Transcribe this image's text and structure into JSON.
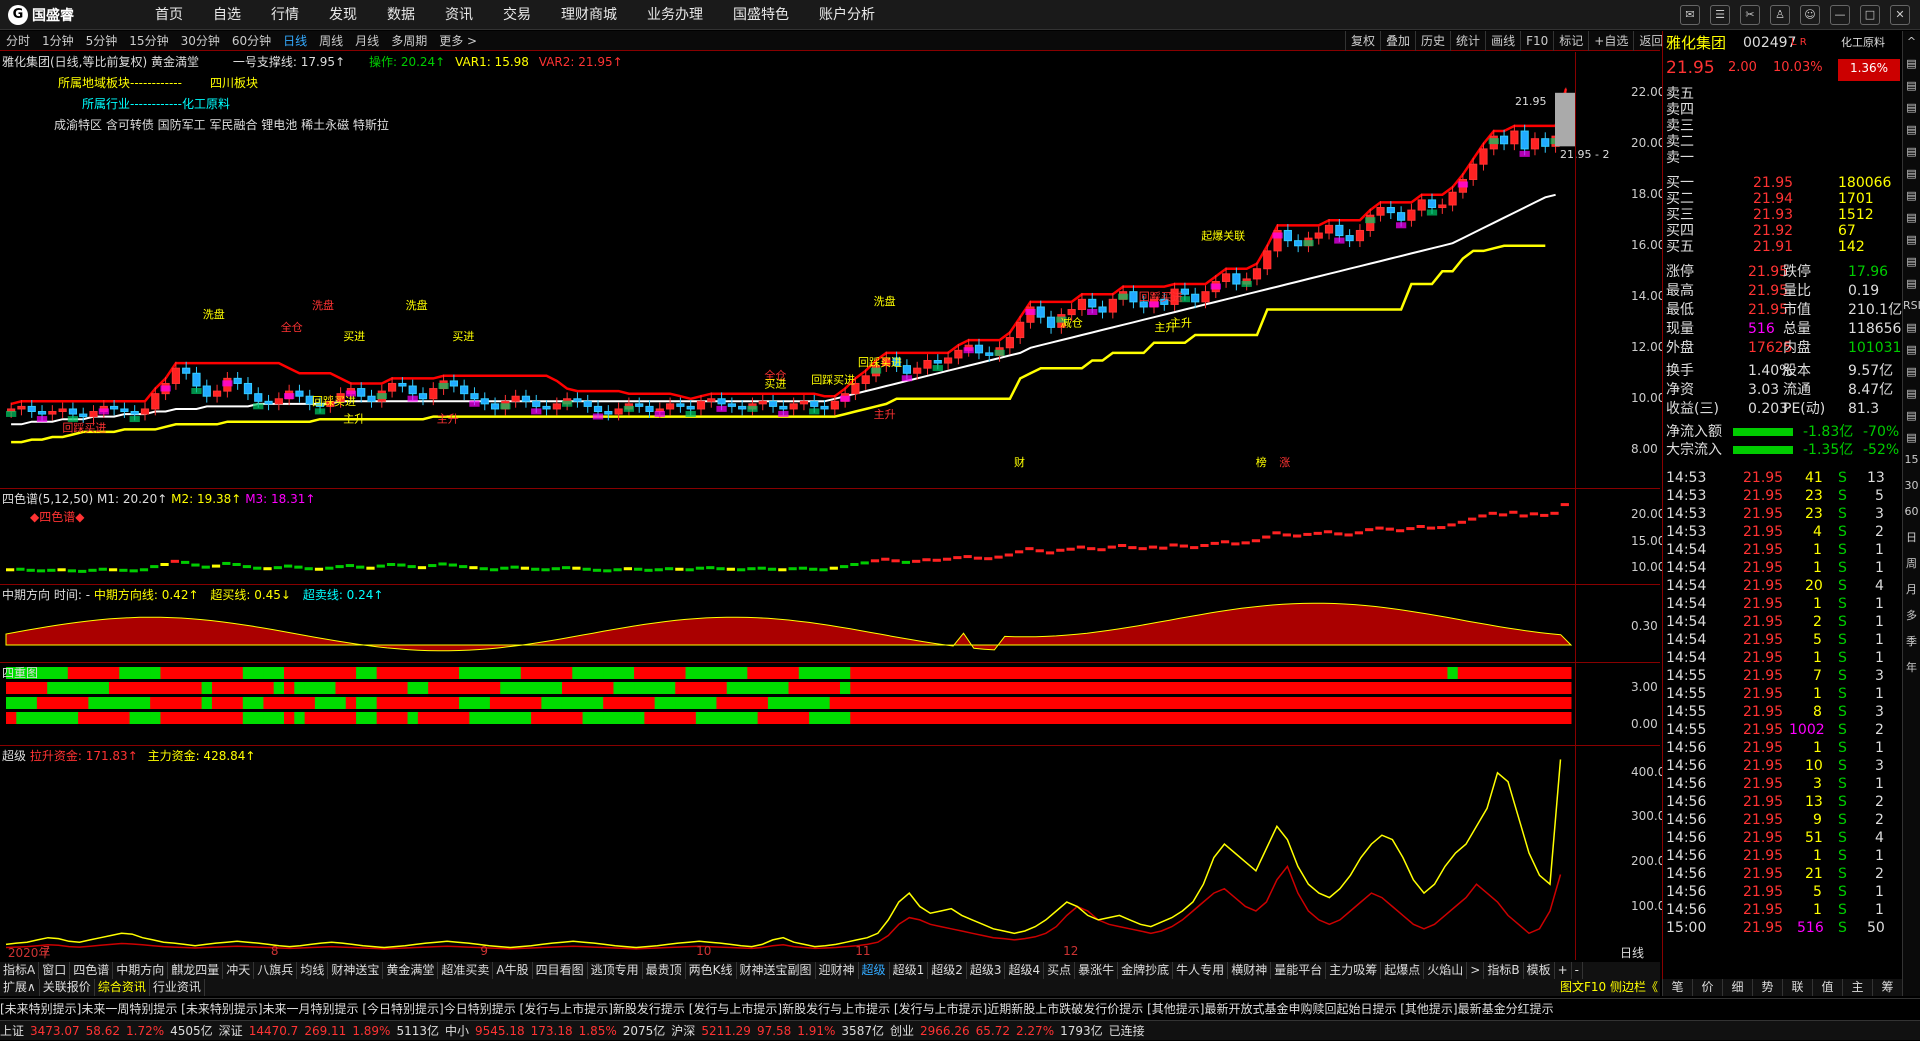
{
  "app": {
    "logo_text": "国盛睿",
    "logo_mark": "G",
    "menu": [
      "首页",
      "自选",
      "行情",
      "发现",
      "数据",
      "资讯",
      "交易",
      "理财商城",
      "业务办理",
      "国盛特色",
      "账户分析"
    ],
    "window_icons": [
      "message-icon",
      "mail-icon",
      "tools-icon",
      "shirt-icon",
      "user-icon",
      "minimize-icon",
      "maximize-icon",
      "close-icon"
    ]
  },
  "period_tabs": [
    "分时",
    "1分钟",
    "5分钟",
    "15分钟",
    "30分钟",
    "60分钟",
    "日线",
    "周线",
    "月线",
    "多周期",
    "更多 >"
  ],
  "active_period": "日线",
  "tool_buttons": [
    "复权",
    "叠加",
    "历史",
    "统计",
    "画线",
    "F10",
    "标记",
    "+自选",
    "返回"
  ],
  "main_header": {
    "title": "雅化集团(日线,等比前复权)",
    "formula": "黄金満堂",
    "support": "一号支撑线: 17.95↑",
    "op": "操作: 20.24↑",
    "var1": "VAR1: 15.98",
    "var2": "VAR2: 21.95↑"
  },
  "info_lines": {
    "region_label": "所属地域板块------------",
    "region_value": "四川板块",
    "industry_label": "所属行业------------化工原料",
    "concepts": "成渝特区 含可转债 国防军工 军民融合 锂电池 稀土永磁 特斯拉"
  },
  "main_axis": [
    "22.00",
    "20.00",
    "18.00",
    "16.00",
    "14.00",
    "12.00",
    "10.00",
    "8.00"
  ],
  "price_labels": {
    "high": "21.95",
    "right": "21.95 - 2"
  },
  "chart_annotations": [
    "洗盘",
    "洗盘",
    "洗盘",
    "洗盘",
    "全仓",
    "买进",
    "买进",
    "回踩买进",
    "回踩买进",
    "主升",
    "主升",
    "回踩买进",
    "起爆关联",
    "回踩买进",
    "主升",
    "主升",
    "全仓",
    "买进",
    "回踩买进",
    "主升",
    "财",
    "榜",
    "涨",
    "减仓"
  ],
  "panel2": {
    "title": "四色谱(5,12,50)",
    "m1": "M1: 20.20↑",
    "m2": "M2: 19.38↑",
    "m3": "M3: 18.31↑",
    "label": "◆四色谱◆",
    "axis": [
      "20.00",
      "15.00",
      "10.00"
    ]
  },
  "panel3": {
    "title": "中期方向",
    "time": "时间: -",
    "line": "中期方向线: 0.42↑",
    "buy": "超买线: 0.45↓",
    "sell": "超卖线: 0.24↑",
    "axis": [
      "0.30"
    ]
  },
  "panel4": {
    "title": "四重图",
    "axis": [
      "3.00",
      "0.00"
    ]
  },
  "panel5": {
    "title": "超级",
    "pull": "拉升资金: 171.83↑",
    "main": "主力资金: 428.84↑",
    "axis": [
      "400.0",
      "300.0",
      "200.0",
      "100.0"
    ]
  },
  "x_axis": [
    {
      "label": "2020年",
      "pos": 0.005
    },
    {
      "label": "7",
      "pos": 0.027
    },
    {
      "label": "8",
      "pos": 0.172
    },
    {
      "label": "9",
      "pos": 0.305
    },
    {
      "label": "10",
      "pos": 0.442
    },
    {
      "label": "11",
      "pos": 0.543
    },
    {
      "label": "12",
      "pos": 0.675
    }
  ],
  "x_axis_right": "日线",
  "bottom_tabs": [
    "指标A",
    "窗口",
    "四色谱",
    "中期方向",
    "麒龙四量",
    "冲天",
    "八旗兵",
    "均线",
    "财神送宝",
    "黄金满堂",
    "超准买卖",
    "A牛股",
    "四目看图",
    "逃顶专用",
    "最贵顶",
    "两色K线",
    "财神送宝副图",
    "迎财神",
    "超级",
    "超级1",
    "超级2",
    "超级3",
    "超级4",
    "买点",
    "暴涨牛",
    "金牌抄底",
    "牛人专用",
    "横财神",
    "量能平台",
    "主力吸筹",
    "起爆点",
    "火焰山",
    ">",
    "指标B",
    "模板",
    "+",
    "-"
  ],
  "active_tab": "超级",
  "bottom_tabs2": [
    "扩展∧",
    "关联报价",
    "综合资讯",
    "行业资讯"
  ],
  "bottom_tabs2_active": "综合资讯",
  "f10_label": "图文F10 侧边栏《",
  "stock": {
    "name": "雅化集团",
    "code": "002497",
    "tag": "L R",
    "industry": "化工原料",
    "industry_pct": "1.36%",
    "price": "21.95",
    "chg": "2.00",
    "pct": "10.03%"
  },
  "sell_levels": [
    "卖五",
    "卖四",
    "卖三",
    "卖二",
    "卖一"
  ],
  "buy_levels": [
    {
      "l": "买一",
      "p": "21.95",
      "v": "180066"
    },
    {
      "l": "买二",
      "p": "21.94",
      "v": "1701"
    },
    {
      "l": "买三",
      "p": "21.93",
      "v": "1512"
    },
    {
      "l": "买四",
      "p": "21.92",
      "v": "67"
    },
    {
      "l": "买五",
      "p": "21.91",
      "v": "142"
    }
  ],
  "stats": [
    {
      "a": "涨停",
      "av": "21.95",
      "b": "跌停",
      "bv": "17.96",
      "ac": "up",
      "bc": "dn"
    },
    {
      "a": "最高",
      "av": "21.95",
      "b": "量比",
      "bv": "0.19",
      "ac": "up",
      "bc": "wh"
    },
    {
      "a": "最低",
      "av": "21.95",
      "b": "市值",
      "bv": "210.1亿",
      "ac": "up",
      "bc": "wh"
    },
    {
      "a": "现量",
      "av": "516",
      "b": "总量",
      "bv": "118656",
      "ac": "mg",
      "bc": "wh"
    },
    {
      "a": "外盘",
      "av": "17625",
      "b": "内盘",
      "bv": "101031",
      "ac": "up",
      "bc": "dn"
    },
    {
      "a": "换手",
      "av": "1.40%",
      "b": "股本",
      "bv": "9.57亿",
      "ac": "wh",
      "bc": "wh"
    },
    {
      "a": "净资",
      "av": "3.03",
      "b": "流通",
      "bv": "8.47亿",
      "ac": "wh",
      "bc": "wh"
    },
    {
      "a": "收益(三)",
      "av": "0.203",
      "b": "PE(动)",
      "bv": "81.3",
      "ac": "wh",
      "bc": "wh"
    }
  ],
  "flows": [
    {
      "l": "净流入额",
      "v": "-1.83亿",
      "p": "-70%"
    },
    {
      "l": "大宗流入",
      "v": "-1.35亿",
      "p": "-52%"
    }
  ],
  "ticks": [
    [
      "14:53",
      "21.95",
      "41",
      "S",
      "13"
    ],
    [
      "14:53",
      "21.95",
      "23",
      "S",
      "5"
    ],
    [
      "14:53",
      "21.95",
      "23",
      "S",
      "3"
    ],
    [
      "14:53",
      "21.95",
      "4",
      "S",
      "2"
    ],
    [
      "14:54",
      "21.95",
      "1",
      "S",
      "1"
    ],
    [
      "14:54",
      "21.95",
      "1",
      "S",
      "1"
    ],
    [
      "14:54",
      "21.95",
      "20",
      "S",
      "4"
    ],
    [
      "14:54",
      "21.95",
      "1",
      "S",
      "1"
    ],
    [
      "14:54",
      "21.95",
      "2",
      "S",
      "1"
    ],
    [
      "14:54",
      "21.95",
      "5",
      "S",
      "1"
    ],
    [
      "14:54",
      "21.95",
      "1",
      "S",
      "1"
    ],
    [
      "14:55",
      "21.95",
      "7",
      "S",
      "3"
    ],
    [
      "14:55",
      "21.95",
      "1",
      "S",
      "1"
    ],
    [
      "14:55",
      "21.95",
      "8",
      "S",
      "3"
    ],
    [
      "14:55",
      "21.95",
      "1002",
      "S",
      "2"
    ],
    [
      "14:56",
      "21.95",
      "1",
      "S",
      "1"
    ],
    [
      "14:56",
      "21.95",
      "10",
      "S",
      "3"
    ],
    [
      "14:56",
      "21.95",
      "3",
      "S",
      "1"
    ],
    [
      "14:56",
      "21.95",
      "13",
      "S",
      "2"
    ],
    [
      "14:56",
      "21.95",
      "9",
      "S",
      "2"
    ],
    [
      "14:56",
      "21.95",
      "51",
      "S",
      "4"
    ],
    [
      "14:56",
      "21.95",
      "1",
      "S",
      "1"
    ],
    [
      "14:56",
      "21.95",
      "21",
      "S",
      "2"
    ],
    [
      "14:56",
      "21.95",
      "5",
      "S",
      "1"
    ],
    [
      "14:56",
      "21.95",
      "1",
      "S",
      "1"
    ],
    [
      "15:00",
      "21.95",
      "516",
      "S",
      "50"
    ]
  ],
  "right_tabs": [
    "笔",
    "价",
    "细",
    "势",
    "联",
    "值",
    "主",
    "筹"
  ],
  "sidebar_icons": [
    "^",
    "▤",
    "▤",
    "▤",
    "▤",
    "▤",
    "▤",
    "▤",
    "▤",
    "▤",
    "▤",
    "▤",
    "RSI",
    "▤",
    "▤",
    "▤",
    "▤",
    "▤",
    "▤",
    "15",
    "30",
    "60",
    "日",
    "周",
    "月",
    "多",
    "季",
    "年"
  ],
  "ticker": "[未来特别提示]未来一周特别提示   [未来特别提示]未来一月特别提示   [今日特别提示]今日特别提示   [发行与上市提示]新股发行提示   [发行与上市提示]新股发行与上市提示   [发行与上市提示]近期新股上市跌破发行价提示   [其他提示]最新开放式基金申购赎回起始日提示   [其他提示]最新基金分红提示",
  "status_items": [
    {
      "t": "上证",
      "c": "wh"
    },
    {
      "t": "3473.07",
      "c": "up"
    },
    {
      "t": "58.62",
      "c": "up"
    },
    {
      "t": "1.72%",
      "c": "up"
    },
    {
      "t": "4505亿",
      "c": "wh"
    },
    {
      "t": "深证",
      "c": "wh"
    },
    {
      "t": "14470.7",
      "c": "up"
    },
    {
      "t": "269.11",
      "c": "up"
    },
    {
      "t": "1.89%",
      "c": "up"
    },
    {
      "t": "5113亿",
      "c": "wh"
    },
    {
      "t": "中小",
      "c": "wh"
    },
    {
      "t": "9545.18",
      "c": "up"
    },
    {
      "t": "173.18",
      "c": "up"
    },
    {
      "t": "1.85%",
      "c": "up"
    },
    {
      "t": "2075亿",
      "c": "wh"
    },
    {
      "t": "沪深",
      "c": "wh"
    },
    {
      "t": "5211.29",
      "c": "up"
    },
    {
      "t": "97.58",
      "c": "up"
    },
    {
      "t": "1.91%",
      "c": "up"
    },
    {
      "t": "3587亿",
      "c": "wh"
    },
    {
      "t": "创业",
      "c": "wh"
    },
    {
      "t": "2966.26",
      "c": "up"
    },
    {
      "t": "65.72",
      "c": "up"
    },
    {
      "t": "2.27%",
      "c": "up"
    },
    {
      "t": "1793亿",
      "c": "wh"
    },
    {
      "t": "已连接",
      "c": "wh"
    }
  ],
  "chart_data": {
    "type": "candlestick",
    "ylim": [
      7,
      23
    ],
    "close": [
      9.6,
      9.7,
      9.5,
      9.4,
      9.5,
      9.6,
      9.4,
      9.3,
      9.5,
      9.7,
      9.6,
      9.5,
      9.4,
      9.6,
      10.2,
      10.6,
      11.2,
      11.0,
      10.5,
      10.1,
      10.3,
      10.8,
      10.6,
      10.2,
      9.9,
      9.8,
      10.0,
      10.3,
      10.1,
      9.8,
      9.7,
      9.9,
      10.2,
      10.4,
      10.1,
      9.9,
      10.3,
      10.6,
      10.5,
      10.2,
      10.0,
      10.4,
      10.7,
      10.5,
      10.2,
      10.0,
      9.8,
      9.6,
      9.9,
      10.1,
      9.9,
      9.7,
      9.6,
      9.8,
      10.0,
      9.9,
      9.7,
      9.5,
      9.4,
      9.6,
      9.8,
      9.7,
      9.5,
      9.6,
      9.8,
      9.7,
      9.6,
      9.9,
      10.0,
      9.8,
      9.7,
      9.6,
      9.8,
      9.9,
      9.7,
      9.6,
      9.8,
      9.9,
      9.7,
      9.6,
      9.9,
      10.2,
      10.6,
      10.9,
      11.3,
      11.6,
      11.3,
      11.0,
      11.2,
      11.5,
      11.4,
      11.6,
      11.9,
      12.1,
      11.8,
      11.7,
      12.0,
      12.4,
      13.0,
      13.6,
      13.2,
      12.8,
      13.3,
      13.5,
      13.9,
      13.6,
      13.4,
      13.9,
      14.2,
      13.8,
      13.6,
      13.9,
      13.7,
      14.3,
      14.1,
      13.8,
      14.2,
      14.6,
      14.9,
      14.5,
      14.7,
      15.1,
      15.8,
      16.6,
      16.2,
      16.0,
      16.3,
      16.5,
      16.8,
      16.4,
      16.2,
      16.6,
      17.2,
      17.5,
      17.3,
      17.0,
      17.4,
      17.8,
      17.5,
      17.6,
      18.1,
      18.6,
      19.2,
      19.8,
      20.3,
      20.0,
      20.5,
      19.8,
      20.2,
      19.9,
      20.3,
      21.95
    ],
    "support": [
      8.3,
      8.3,
      8.4,
      8.4,
      8.5,
      8.5,
      8.6,
      8.7,
      8.7,
      8.7,
      8.7,
      8.8,
      8.8,
      8.8,
      8.8,
      8.9,
      9.0,
      9.0,
      9.0,
      9.0,
      9.0,
      9.1,
      9.1,
      9.1,
      9.1,
      9.1,
      9.1,
      9.1,
      9.1,
      9.1,
      9.2,
      9.2,
      9.2,
      9.2,
      9.2,
      9.2,
      9.2,
      9.2,
      9.2,
      9.2,
      9.2,
      9.3,
      9.3,
      9.3,
      9.3,
      9.3,
      9.3,
      9.3,
      9.3,
      9.3,
      9.3,
      9.3,
      9.3,
      9.3,
      9.3,
      9.3,
      9.3,
      9.3,
      9.3,
      9.3,
      9.3,
      9.3,
      9.3,
      9.3,
      9.3,
      9.3,
      9.3,
      9.3,
      9.3,
      9.3,
      9.3,
      9.3,
      9.3,
      9.3,
      9.3,
      9.3,
      9.3,
      9.3,
      9.3,
      9.3,
      9.3,
      9.4,
      9.5,
      9.6,
      9.7,
      9.8,
      10.0,
      10.0,
      10.0,
      10.0,
      10.0,
      10.0,
      10.0,
      10.0,
      10.0,
      10.0,
      10.0,
      10.0,
      10.8,
      11.0,
      11.2,
      11.2,
      11.2,
      11.2,
      11.2,
      11.5,
      11.5,
      11.8,
      11.8,
      11.8,
      11.8,
      12.2,
      12.2,
      12.2,
      12.2,
      12.5,
      12.5,
      12.5,
      12.5,
      12.5,
      12.5,
      12.5,
      13.5,
      13.5,
      13.5,
      13.5,
      13.5,
      13.5,
      13.5,
      13.5,
      13.5,
      13.5,
      13.5,
      13.5,
      13.5,
      13.5,
      14.5,
      14.5,
      14.5,
      15.0,
      15.0,
      15.5,
      15.8,
      15.8,
      15.9,
      16.0,
      16.0,
      16.0,
      16.0,
      16.0
    ],
    "ma": [
      9.0,
      9.0,
      9.1,
      9.1,
      9.1,
      9.2,
      9.2,
      9.2,
      9.3,
      9.3,
      9.3,
      9.4,
      9.4,
      9.4,
      9.5,
      9.5,
      9.6,
      9.6,
      9.6,
      9.7,
      9.7,
      9.7,
      9.7,
      9.7,
      9.8,
      9.8,
      9.8,
      9.8,
      9.8,
      9.8,
      9.8,
      9.8,
      9.9,
      9.9,
      9.9,
      9.9,
      9.9,
      9.9,
      9.9,
      9.9,
      9.9,
      9.9,
      9.9,
      9.9,
      9.9,
      9.9,
      9.9,
      9.9,
      9.9,
      9.9,
      9.9,
      9.9,
      9.9,
      9.9,
      9.9,
      9.9,
      9.9,
      9.9,
      9.9,
      9.9,
      9.9,
      9.9,
      9.9,
      9.9,
      9.9,
      9.9,
      9.9,
      9.9,
      9.9,
      9.9,
      9.9,
      9.9,
      9.9,
      9.9,
      9.9,
      9.9,
      9.9,
      9.9,
      9.9,
      9.9,
      10.0,
      10.1,
      10.2,
      10.3,
      10.4,
      10.5,
      10.6,
      10.7,
      10.8,
      10.9,
      11.0,
      11.1,
      11.2,
      11.3,
      11.4,
      11.5,
      11.6,
      11.7,
      11.8,
      12.0,
      12.1,
      12.2,
      12.3,
      12.4,
      12.5,
      12.6,
      12.7,
      12.8,
      12.9,
      13.0,
      13.1,
      13.2,
      13.3,
      13.4,
      13.5,
      13.6,
      13.7,
      13.8,
      13.9,
      14.0,
      14.1,
      14.2,
      14.3,
      14.4,
      14.5,
      14.6,
      14.7,
      14.8,
      14.9,
      15.0,
      15.1,
      15.2,
      15.3,
      15.4,
      15.5,
      15.6,
      15.7,
      15.8,
      15.9,
      16.0,
      16.1,
      16.3,
      16.5,
      16.7,
      16.9,
      17.1,
      17.3,
      17.5,
      17.7,
      17.9,
      18.0
    ]
  },
  "super_chart": {
    "ylim": [
      0,
      430
    ],
    "main": [
      15,
      18,
      20,
      25,
      30,
      28,
      22,
      20,
      25,
      30,
      35,
      40,
      38,
      30,
      25,
      20,
      18,
      15,
      12,
      15,
      18,
      20,
      22,
      20,
      18,
      15,
      12,
      10,
      12,
      15,
      18,
      20,
      18,
      15,
      12,
      10,
      8,
      10,
      12,
      15,
      18,
      20,
      22,
      20,
      18,
      15,
      12,
      10,
      8,
      10,
      12,
      15,
      18,
      20,
      22,
      20,
      18,
      15,
      12,
      10,
      8,
      10,
      12,
      15,
      18,
      20,
      22,
      20,
      18,
      15,
      12,
      10,
      15,
      25,
      30,
      20,
      15,
      10,
      12,
      15,
      20,
      25,
      30,
      40,
      70,
      110,
      130,
      100,
      85,
      90,
      95,
      80,
      70,
      60,
      50,
      45,
      40,
      45,
      55,
      70,
      90,
      110,
      100,
      80,
      70,
      75,
      80,
      70,
      60,
      55,
      65,
      75,
      90,
      110,
      150,
      210,
      240,
      220,
      200,
      180,
      230,
      280,
      250,
      190,
      150,
      130,
      120,
      140,
      170,
      210,
      240,
      260,
      250,
      210,
      160,
      130,
      150,
      190,
      220,
      240,
      280,
      320,
      400,
      380,
      300,
      220,
      170,
      150,
      430
    ],
    "pull": [
      8,
      9,
      10,
      12,
      14,
      13,
      10,
      9,
      11,
      13,
      15,
      17,
      16,
      14,
      12,
      10,
      9,
      8,
      7,
      8,
      9,
      10,
      11,
      10,
      9,
      8,
      7,
      6,
      7,
      8,
      9,
      10,
      9,
      8,
      7,
      6,
      5,
      6,
      7,
      8,
      9,
      10,
      11,
      10,
      9,
      8,
      7,
      6,
      5,
      6,
      7,
      8,
      9,
      10,
      11,
      10,
      9,
      8,
      7,
      6,
      5,
      6,
      7,
      8,
      9,
      10,
      11,
      10,
      9,
      8,
      7,
      6,
      8,
      12,
      14,
      10,
      8,
      6,
      7,
      8,
      10,
      12,
      15,
      20,
      35,
      60,
      75,
      70,
      60,
      55,
      50,
      45,
      40,
      35,
      30,
      28,
      25,
      28,
      32,
      40,
      55,
      80,
      100,
      90,
      70,
      60,
      55,
      50,
      45,
      40,
      45,
      55,
      70,
      90,
      110,
      130,
      140,
      120,
      100,
      90,
      110,
      160,
      190,
      130,
      90,
      70,
      60,
      70,
      90,
      110,
      130,
      120,
      100,
      80,
      60,
      50,
      60,
      80,
      100,
      120,
      150,
      130,
      110,
      80,
      60,
      40,
      50,
      90,
      171.83
    ]
  }
}
